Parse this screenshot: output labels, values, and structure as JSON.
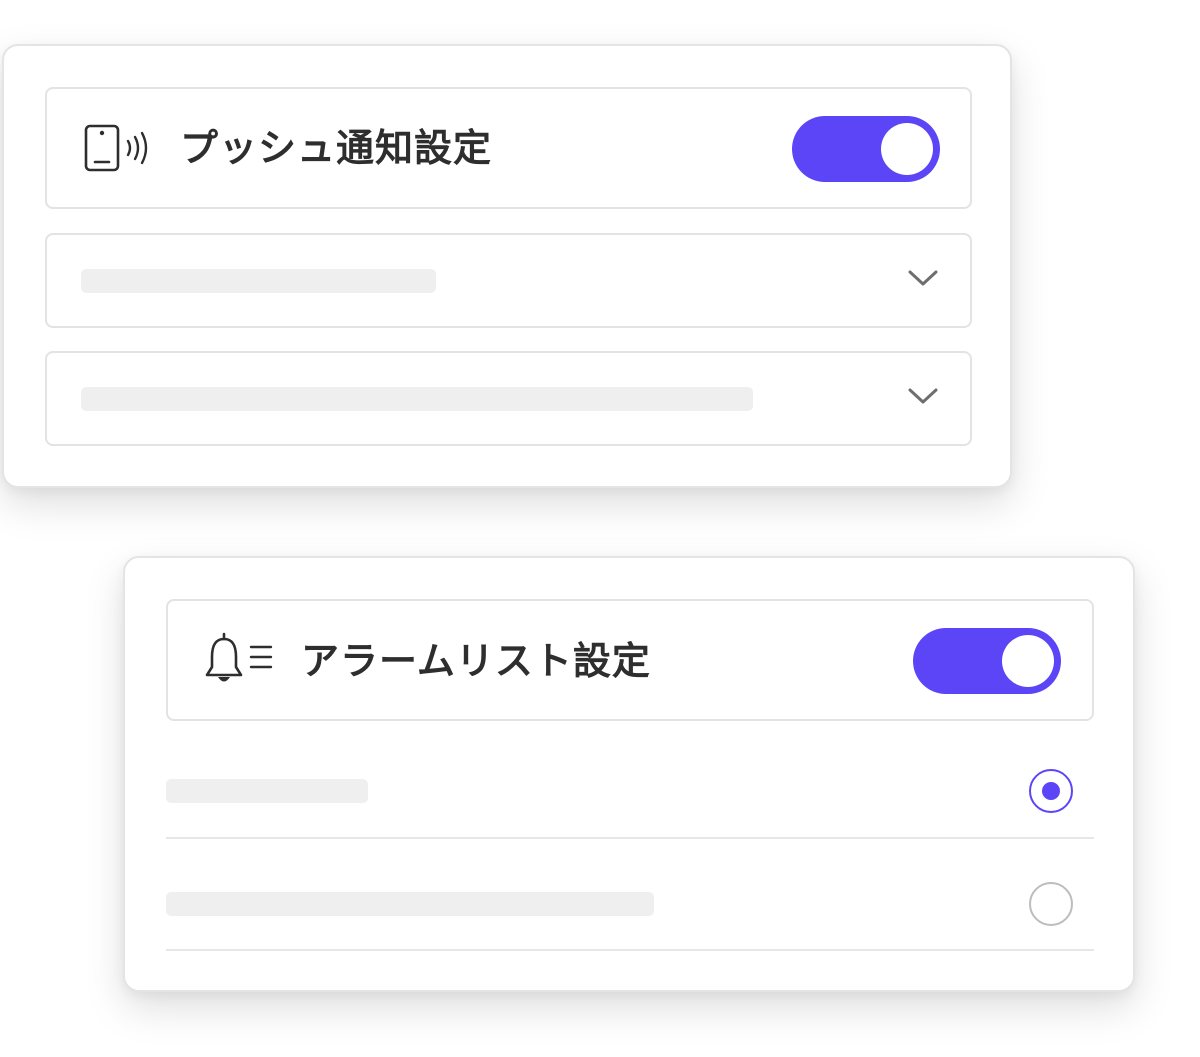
{
  "push_settings": {
    "title": "プッシュ通知設定",
    "icon": "phone-vibrate-icon",
    "toggle_on": true,
    "dropdowns": [
      {
        "icon": "chevron-down-icon"
      },
      {
        "icon": "chevron-down-icon"
      }
    ]
  },
  "alarm_settings": {
    "title": "アラームリスト設定",
    "icon": "bell-list-icon",
    "toggle_on": true,
    "options": [
      {
        "selected": true
      },
      {
        "selected": false
      }
    ]
  },
  "colors": {
    "accent": "#5b45f6",
    "placeholder": "#efefef",
    "border": "#e3e3e3",
    "text": "#2e2e2e"
  }
}
